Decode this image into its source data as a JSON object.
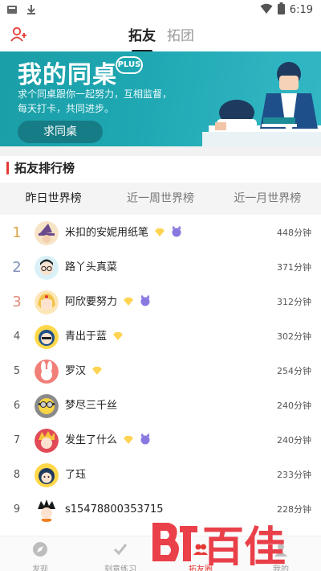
{
  "statusbar": {
    "time": "6:19"
  },
  "topnav": {
    "tabs": [
      {
        "label": "拓友"
      },
      {
        "label": "拓团"
      }
    ]
  },
  "banner": {
    "title": "我的同桌",
    "badge": "PLUS",
    "line1": "求个同桌跟你一起努力，互相监督，",
    "line2": "每天打卡，共同进步。",
    "cta": "求同桌"
  },
  "section": {
    "title": "拓友排行榜"
  },
  "subtabs": [
    {
      "label": "昨日世界榜"
    },
    {
      "label": "近一周世界榜"
    },
    {
      "label": "近一月世界榜"
    }
  ],
  "leaderboard": [
    {
      "rank": "1",
      "name": "米扣的安妮用纸笔",
      "minutes": "448分钟",
      "badges": [
        "gem-badge-icon",
        "devil-badge-icon"
      ],
      "avatar": "witch-hat-avatar"
    },
    {
      "rank": "2",
      "name": "路丫头真菜",
      "minutes": "371分钟",
      "badges": [],
      "avatar": "boy-glasses-avatar"
    },
    {
      "rank": "3",
      "name": "阿欣要努力",
      "minutes": "312分钟",
      "badges": [
        "gem-badge-icon",
        "devil-badge-icon"
      ],
      "avatar": "sailor-moon-avatar"
    },
    {
      "rank": "4",
      "name": "青出于蓝",
      "minutes": "302分钟",
      "badges": [
        "gem-badge-icon"
      ],
      "avatar": "hooded-boy-avatar"
    },
    {
      "rank": "5",
      "name": "罗汉",
      "minutes": "254分钟",
      "badges": [
        "gem-badge-icon"
      ],
      "avatar": "bunny-avatar"
    },
    {
      "rank": "6",
      "name": "梦尽三千丝",
      "minutes": "240分钟",
      "badges": [],
      "avatar": "minion-avatar"
    },
    {
      "rank": "7",
      "name": "发生了什么",
      "minutes": "240分钟",
      "badges": [
        "gem-badge-icon",
        "devil-badge-icon"
      ],
      "avatar": "naruto-avatar"
    },
    {
      "rank": "8",
      "name": "了珏",
      "minutes": "233分钟",
      "badges": [],
      "avatar": "penguin-hood-avatar"
    },
    {
      "rank": "9",
      "name": "s15478800353715",
      "minutes": "228分钟",
      "badges": [],
      "avatar": "goku-avatar"
    }
  ],
  "bottombar": [
    {
      "label": "发现",
      "icon": "compass-icon"
    },
    {
      "label": "刻意练习",
      "icon": "check-icon"
    },
    {
      "label": "拓友圈",
      "icon": "friends-icon"
    },
    {
      "label": "我的",
      "icon": "profile-icon"
    }
  ],
  "watermark": {
    "text": "百佳"
  },
  "colors": {
    "accent": "#e53935",
    "banner": "#1fa8b3",
    "gold": "#d7a64a",
    "silver": "#7e8fb7",
    "bronze": "#e08a78"
  }
}
